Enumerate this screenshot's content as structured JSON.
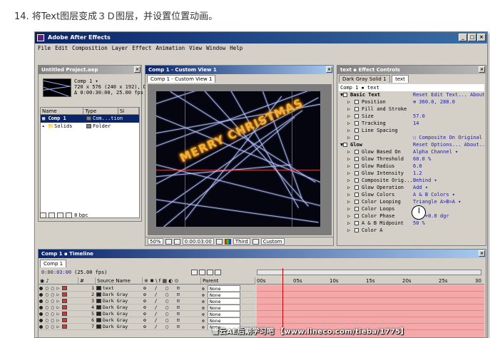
{
  "tutorial_caption": "14. 将Text图层变成３Ｄ图层，并设置位置动画。",
  "app": {
    "title": "Adobe After Effects",
    "menu": [
      "File",
      "Edit",
      "Composition",
      "Layer",
      "Effect",
      "Animation",
      "View",
      "Window",
      "Help"
    ]
  },
  "project": {
    "title": "Untitled Project.aep",
    "comp_name": "Comp 1 ▾",
    "info": [
      "720 x 576  (240 x 192), D",
      "Δ 0:00:30:00, 25.00 fps"
    ],
    "columns": [
      "Name",
      "Type",
      "Si"
    ],
    "items": [
      {
        "name": "Comp 1",
        "type": "Com...tion",
        "selected": true
      },
      {
        "name": "Solids",
        "type": "Folder",
        "selected": false
      }
    ],
    "footer_bpc": "8 bpc"
  },
  "comp": {
    "title": "Comp 1 - Custom View 1",
    "tab": "Comp 1 - Custom View 1",
    "canvas_text": "MERRY CHRISTMAS",
    "zoom": "50%",
    "time": "0:00:03:00",
    "view3d": "Third",
    "view_custom": "Custom"
  },
  "effect_controls": {
    "title": "text ▪ Effect Controls",
    "tab_solid": "Dark Gray Solid 1",
    "tab_text": "text",
    "breadcrumb": "Comp 1 ▪ text",
    "basic_text": {
      "label": "Basic Text",
      "reset": "Reset  Edit Text...  About..."
    },
    "rows": [
      {
        "label": "Position",
        "value": "⊕ 360.0, 288.0"
      },
      {
        "label": "Fill and Stroke",
        "value": ""
      },
      {
        "label": "Size",
        "value": "57.0"
      },
      {
        "label": "Tracking",
        "value": "14"
      },
      {
        "label": "Line Spacing",
        "value": ""
      },
      {
        "label": "",
        "value": "☐ Composite On Original"
      }
    ],
    "glow": {
      "label": "Glow",
      "reset": "Reset  Options...  About..."
    },
    "glow_rows": [
      {
        "label": "Glow Based On",
        "value": "Alpha Channel ▾"
      },
      {
        "label": "Glow Threshold",
        "value": "60.0 %"
      },
      {
        "label": "Glow Radius",
        "value": "6.0"
      },
      {
        "label": "Glow Intensity",
        "value": "1.2"
      },
      {
        "label": "Composite Orig...",
        "value": "Behind ▾"
      },
      {
        "label": "Glow Operation",
        "value": "Add ▾"
      },
      {
        "label": "Glow Colors",
        "value": "A & B Colors ▾"
      },
      {
        "label": "Color Looping",
        "value": "Triangle A>B>A ▾"
      },
      {
        "label": "Color Loops",
        "value": "1.0"
      },
      {
        "label": "Color Phase",
        "value": "0 x +0.0 dgr"
      },
      {
        "label": "A & B Midpoint",
        "value": "50 %"
      },
      {
        "label": "Color A",
        "value": ""
      }
    ]
  },
  "timeline": {
    "title": "Comp 1 ▪ Timeline",
    "tab": "Comp 1",
    "time": "0:00:03:00",
    "fps": "(25.00 fps)",
    "columns": [
      "#",
      "Source Name",
      "",
      "Parent"
    ],
    "ruler": [
      "00s",
      "05s",
      "10s",
      "15s",
      "20s",
      "25s",
      "30"
    ],
    "layers": [
      {
        "num": "1",
        "name": "text",
        "parent": "None"
      },
      {
        "num": "2",
        "name": "Dark Gray",
        "parent": "None"
      },
      {
        "num": "3",
        "name": "Dark Gray",
        "parent": "None"
      },
      {
        "num": "4",
        "name": "Dark Gray",
        "parent": "None"
      },
      {
        "num": "5",
        "name": "Dark Gray",
        "parent": "None"
      },
      {
        "num": "6",
        "name": "Dark Gray",
        "parent": "None"
      },
      {
        "num": "7",
        "name": "Dark Gray",
        "parent": "None"
      }
    ]
  },
  "watermark": "雪云AE后期学习吧 【www.lineco.com/tieba/1775】"
}
